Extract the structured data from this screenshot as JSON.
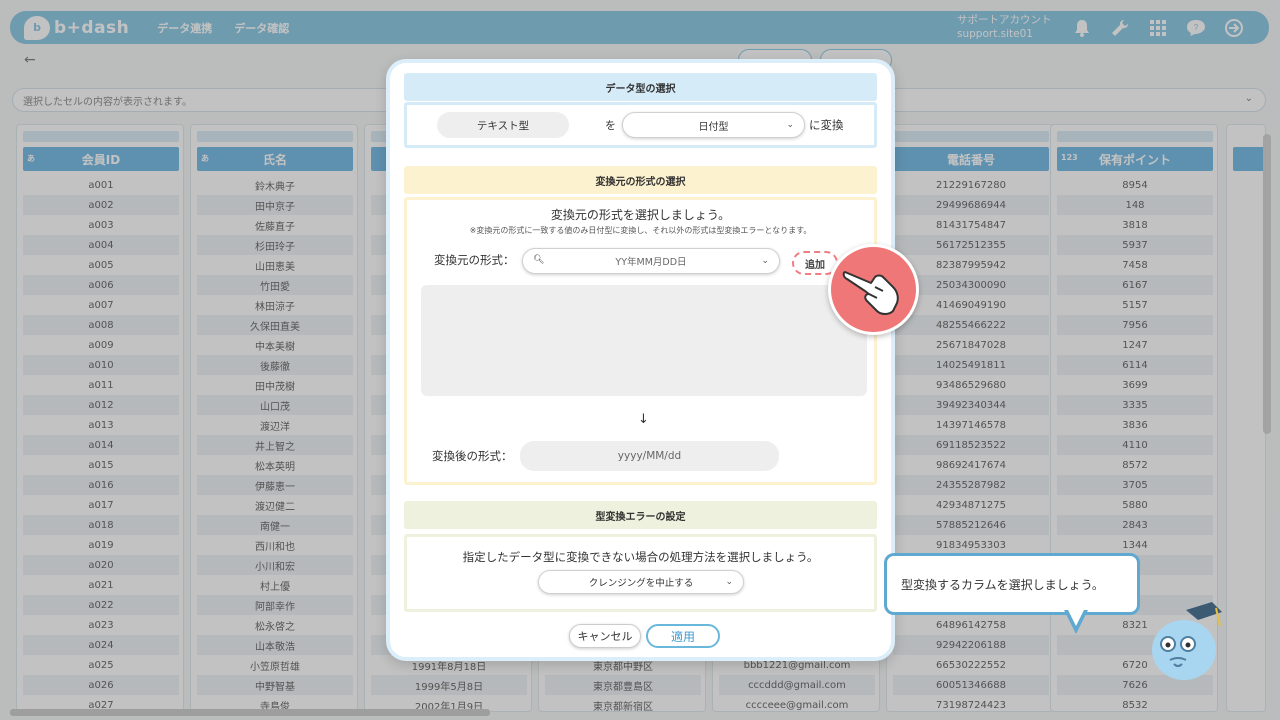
{
  "header": {
    "logo_mark": "b",
    "logo_text": "b+dash",
    "nav": [
      "データ連携",
      "データ確認"
    ],
    "account_label": "サポートアカウント",
    "account_id": "support.site01",
    "icons": [
      "bell-icon",
      "wrench-icon",
      "grid-icon",
      "chat-icon",
      "logout-icon"
    ]
  },
  "cell_bar": {
    "placeholder": "選択したセルの内容が表示されます。"
  },
  "table": {
    "columns": [
      {
        "tag": "あ",
        "name": "会員ID",
        "cells": [
          "a001",
          "a002",
          "a003",
          "a004",
          "a005",
          "a006",
          "a007",
          "a008",
          "a009",
          "a010",
          "a011",
          "a012",
          "a013",
          "a014",
          "a015",
          "a016",
          "a017",
          "a018",
          "a019",
          "a020",
          "a021",
          "a022",
          "a023",
          "a024",
          "a025",
          "a026",
          "a027"
        ]
      },
      {
        "tag": "あ",
        "name": "氏名",
        "cells": [
          "鈴木典子",
          "田中京子",
          "佐藤直子",
          "杉田玲子",
          "山田恵美",
          "竹田愛",
          "林田涼子",
          "久保田直美",
          "中本美樹",
          "後藤徹",
          "田中茂樹",
          "山口茂",
          "渡辺洋",
          "井上智之",
          "松本英明",
          "伊藤恵一",
          "渡辺健二",
          "南健一",
          "西川和也",
          "小川和宏",
          "村上優",
          "阿部幸作",
          "松永啓之",
          "山本敬浩",
          "小笠原哲雄",
          "中野智基",
          "寺島俊"
        ]
      },
      {
        "tag": "",
        "name": "",
        "cells": [
          "",
          "",
          "",
          "",
          "",
          "",
          "",
          "",
          "",
          "",
          "",
          "",
          "",
          "",
          "",
          "",
          "",
          "",
          "",
          "",
          "",
          "",
          "",
          "",
          "1991年8月18日",
          "1999年5月8日",
          "2002年1月9日"
        ]
      },
      {
        "tag": "",
        "name": "",
        "cells": [
          "",
          "",
          "",
          "",
          "",
          "",
          "",
          "",
          "",
          "",
          "",
          "",
          "",
          "",
          "",
          "",
          "",
          "",
          "",
          "",
          "",
          "",
          "",
          "",
          "東京都中野区",
          "東京都豊島区",
          "東京都新宿区"
        ]
      },
      {
        "tag": "",
        "name": "",
        "cells": [
          "",
          "",
          "",
          "",
          "",
          "",
          "",
          "",
          "",
          "",
          "",
          "",
          "",
          "",
          "",
          "",
          "",
          "",
          "",
          "",
          "",
          "",
          "",
          "",
          "bbb1221@gmail.com",
          "cccddd@gmail.com",
          "cccceee@gmail.com"
        ]
      },
      {
        "tag": "",
        "name": "電話番号",
        "cells": [
          "21229167280",
          "29499686944",
          "81431754847",
          "56172512355",
          "82387995942",
          "25034300090",
          "41469049190",
          "48255466222",
          "25671847028",
          "14025491811",
          "93486529680",
          "39492340344",
          "14397146578",
          "69118523522",
          "98692417674",
          "24355287982",
          "42934871275",
          "57885212646",
          "91834953303",
          "",
          "",
          "",
          "64896142758",
          "92942206188",
          "66530222552",
          "60051346688",
          "73198724423"
        ]
      },
      {
        "tag": "123",
        "name": "保有ポイント",
        "cells": [
          "8954",
          "148",
          "3818",
          "5937",
          "7458",
          "6167",
          "5157",
          "7956",
          "1247",
          "6114",
          "3699",
          "3335",
          "3836",
          "4110",
          "8572",
          "3705",
          "5880",
          "2843",
          "1344",
          "",
          "",
          "",
          "8321",
          "",
          "6720",
          "7626",
          "8532"
        ]
      }
    ]
  },
  "modal": {
    "sec1_title": "データ型の選択",
    "from_type": "テキスト型",
    "particle": "を",
    "to_type": "日付型",
    "convert_suffix": "に変換",
    "sec2_title": "変換元の形式の選択",
    "sec2_heading": "変換元の形式を選択しましょう。",
    "sec2_note": "※変換元の形式に一致する値のみ日付型に変換し、それ以外の形式は型変換エラーとなります。",
    "source_label": "変換元の形式：",
    "source_format": "YY年MM月DD日",
    "add_button": "追加",
    "arrow": "↓",
    "target_label": "変換後の形式：",
    "target_format": "yyyy/MM/dd",
    "sec3_title": "型変換エラーの設定",
    "sec3_heading": "指定したデータ型に変換できない場合の処理方法を選択しましょう。",
    "error_option": "クレンジングを中止する",
    "cancel_button": "キャンセル",
    "apply_button": "適用"
  },
  "guide": {
    "bubble_text": "型変換するカラムを選択しましょう。"
  },
  "colors": {
    "accent": "#69b8dc",
    "pointer": "#ef7777"
  }
}
